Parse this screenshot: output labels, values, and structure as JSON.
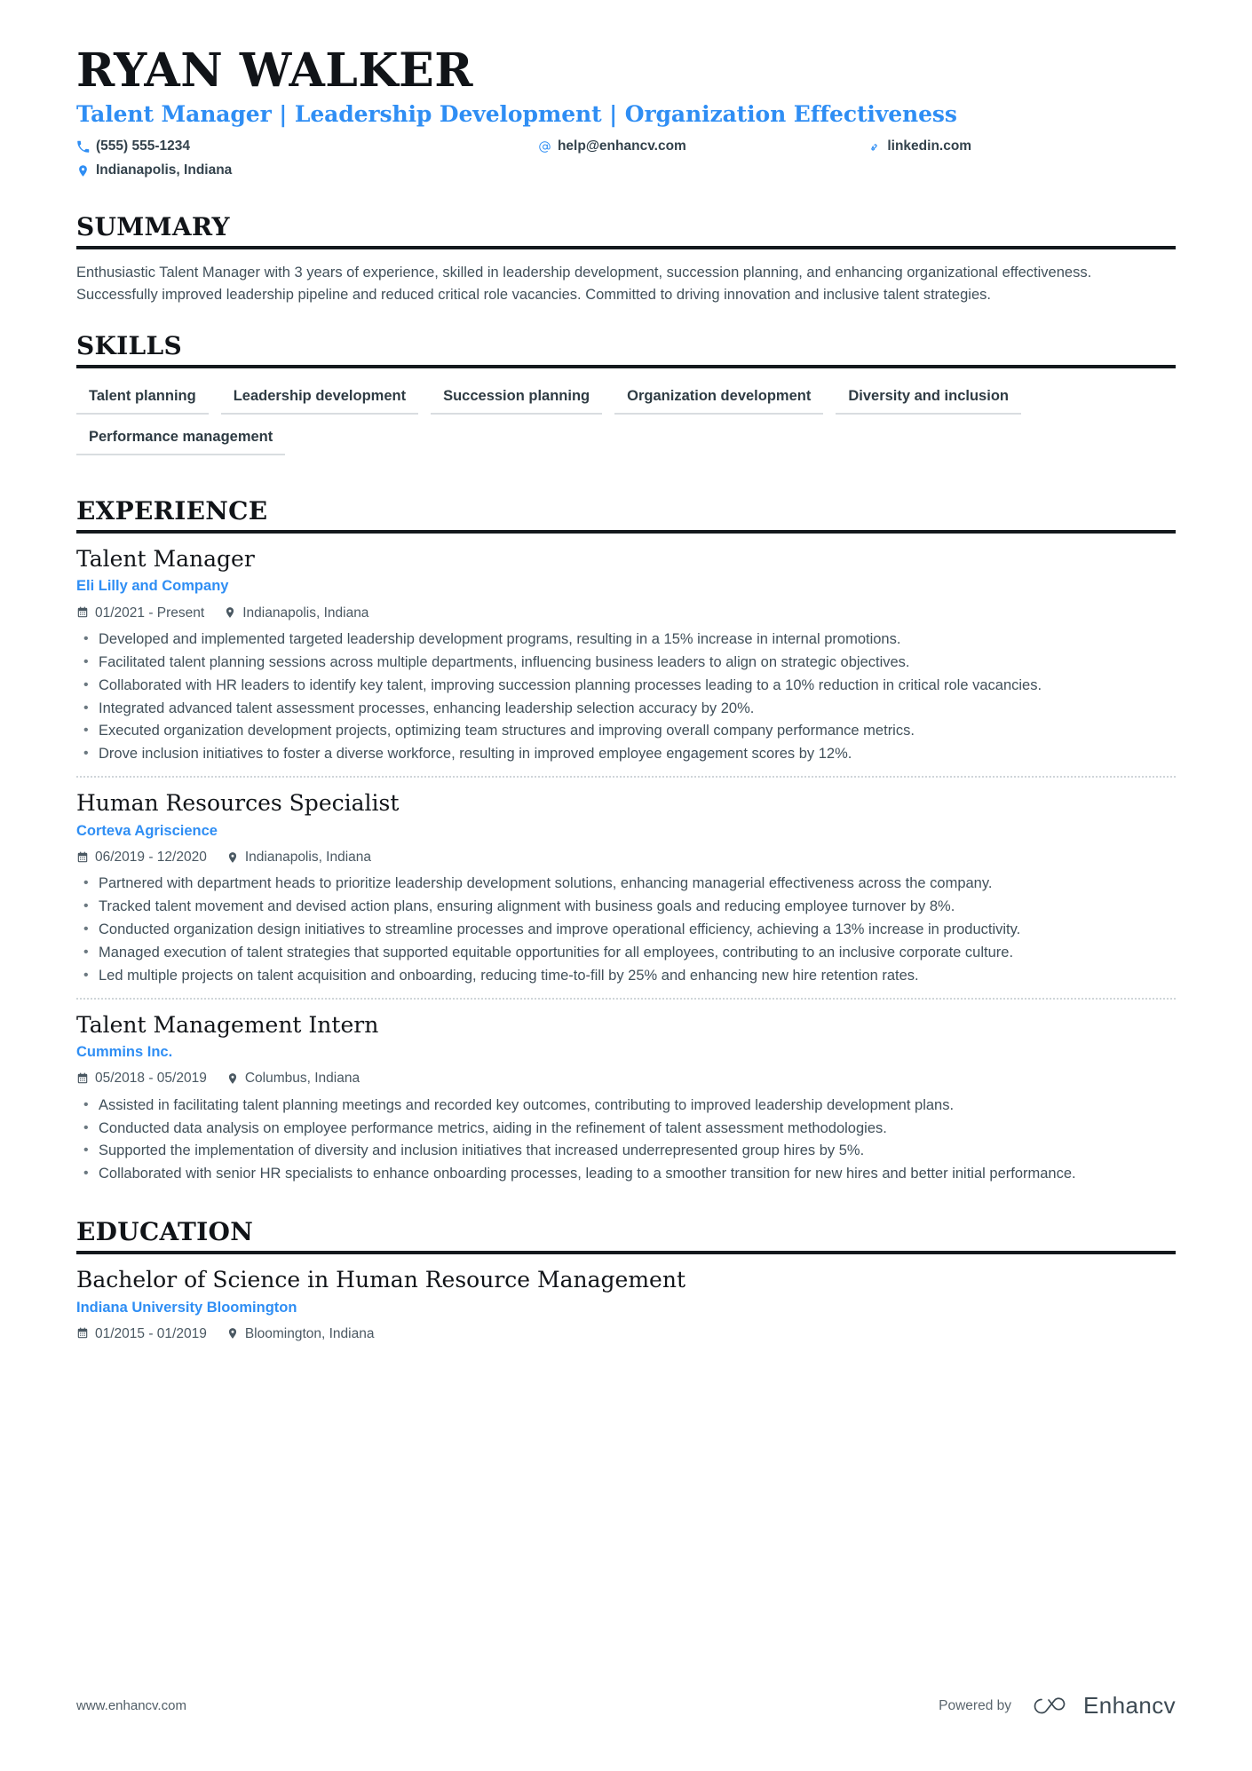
{
  "colors": {
    "accent": "#2f8ef4",
    "heading": "#111418",
    "body": "#41505a",
    "rule": "#14191d",
    "chip_rule": "#d9dde0"
  },
  "header": {
    "name": "RYAN WALKER",
    "headline": "Talent Manager | Leadership Development | Organization Effectiveness",
    "contacts": [
      {
        "icon": "phone-icon",
        "text": "(555) 555-1234"
      },
      {
        "icon": "email-icon",
        "text": "help@enhancv.com"
      },
      {
        "icon": "link-icon",
        "text": "linkedin.com"
      },
      {
        "icon": "location-icon",
        "text": "Indianapolis, Indiana"
      }
    ]
  },
  "summary": {
    "title": "SUMMARY",
    "text": "Enthusiastic Talent Manager with 3 years of experience, skilled in leadership development, succession planning, and enhancing organizational effectiveness. Successfully improved leadership pipeline and reduced critical role vacancies. Committed to driving innovation and inclusive talent strategies."
  },
  "skills": {
    "title": "SKILLS",
    "items": [
      "Talent planning",
      "Leadership development",
      "Succession planning",
      "Organization development",
      "Diversity and inclusion",
      "Performance management"
    ]
  },
  "experience": {
    "title": "EXPERIENCE",
    "entries": [
      {
        "role": "Talent Manager",
        "company": "Eli Lilly and Company",
        "dates": "01/2021 - Present",
        "location": "Indianapolis, Indiana",
        "bullets": [
          "Developed and implemented targeted leadership development programs, resulting in a 15% increase in internal promotions.",
          "Facilitated talent planning sessions across multiple departments, influencing business leaders to align on strategic objectives.",
          "Collaborated with HR leaders to identify key talent, improving succession planning processes leading to a 10% reduction in critical role vacancies.",
          "Integrated advanced talent assessment processes, enhancing leadership selection accuracy by 20%.",
          "Executed organization development projects, optimizing team structures and improving overall company performance metrics.",
          "Drove inclusion initiatives to foster a diverse workforce, resulting in improved employee engagement scores by 12%."
        ]
      },
      {
        "role": "Human Resources Specialist",
        "company": "Corteva Agriscience",
        "dates": "06/2019 - 12/2020",
        "location": "Indianapolis, Indiana",
        "bullets": [
          "Partnered with department heads to prioritize leadership development solutions, enhancing managerial effectiveness across the company.",
          "Tracked talent movement and devised action plans, ensuring alignment with business goals and reducing employee turnover by 8%.",
          "Conducted organization design initiatives to streamline processes and improve operational efficiency, achieving a 13% increase in productivity.",
          "Managed execution of talent strategies that supported equitable opportunities for all employees, contributing to an inclusive corporate culture.",
          "Led multiple projects on talent acquisition and onboarding, reducing time-to-fill by 25% and enhancing new hire retention rates."
        ]
      },
      {
        "role": "Talent Management Intern",
        "company": "Cummins Inc.",
        "dates": "05/2018 - 05/2019",
        "location": "Columbus, Indiana",
        "bullets": [
          "Assisted in facilitating talent planning meetings and recorded key outcomes, contributing to improved leadership development plans.",
          "Conducted data analysis on employee performance metrics, aiding in the refinement of talent assessment methodologies.",
          "Supported the implementation of diversity and inclusion initiatives that increased underrepresented group hires by 5%.",
          "Collaborated with senior HR specialists to enhance onboarding processes, leading to a smoother transition for new hires and better initial performance."
        ]
      }
    ]
  },
  "education": {
    "title": "EDUCATION",
    "entries": [
      {
        "degree": "Bachelor of Science in Human Resource Management",
        "school": "Indiana University Bloomington",
        "dates": "01/2015 - 01/2019",
        "location": "Bloomington, Indiana"
      }
    ]
  },
  "footer": {
    "url": "www.enhancv.com",
    "powered_by": "Powered by",
    "brand": "Enhancv"
  }
}
